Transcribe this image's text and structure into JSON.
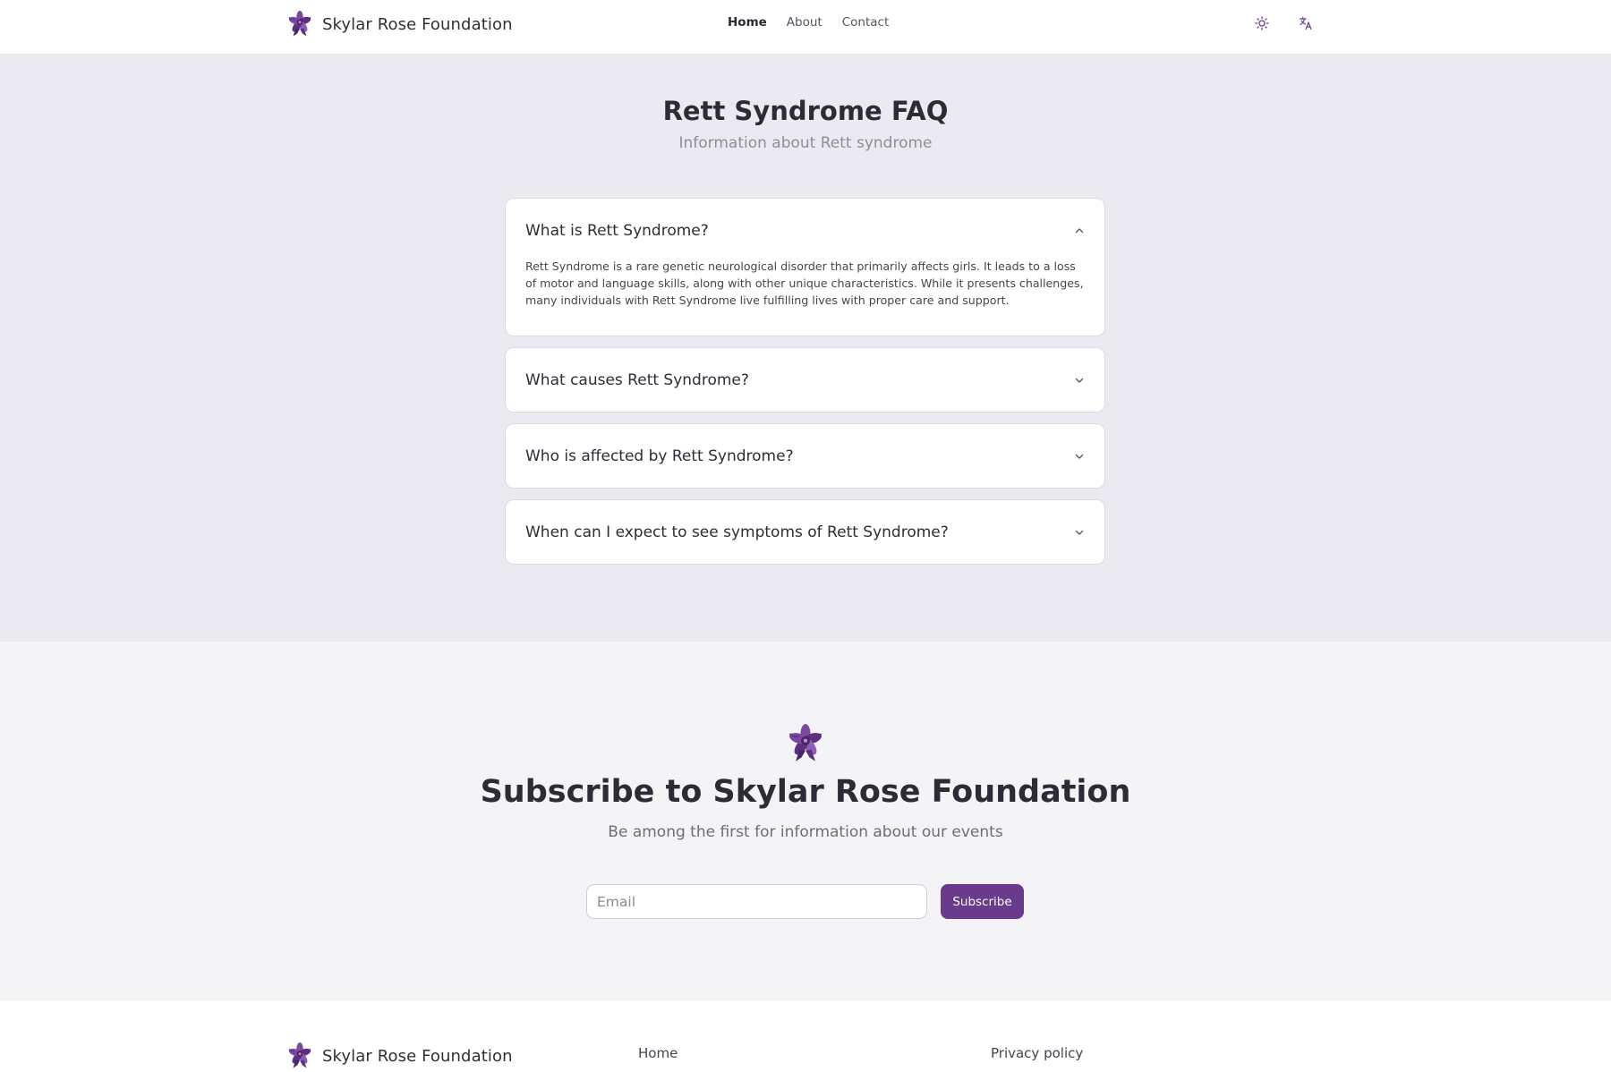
{
  "brand": {
    "name": "Skylar Rose Foundation"
  },
  "nav": {
    "items": [
      {
        "label": "Home",
        "active": true
      },
      {
        "label": "About",
        "active": false
      },
      {
        "label": "Contact",
        "active": false
      }
    ]
  },
  "header_icons": {
    "theme_icon": "sun-icon",
    "language_icon": "translate-icon"
  },
  "faq": {
    "title": "Rett Syndrome FAQ",
    "subtitle": "Information about Rett syndrome",
    "items": [
      {
        "question": "What is Rett Syndrome?",
        "answer": "Rett Syndrome is a rare genetic neurological disorder that primarily affects girls. It leads to a loss of motor and language skills, along with other unique characteristics. While it presents challenges, many individuals with Rett Syndrome live fulfilling lives with proper care and support.",
        "expanded": true
      },
      {
        "question": "What causes Rett Syndrome?",
        "expanded": false
      },
      {
        "question": "Who is affected by Rett Syndrome?",
        "expanded": false
      },
      {
        "question": "When can I expect to see symptoms of Rett Syndrome?",
        "expanded": false
      }
    ]
  },
  "subscribe": {
    "title": "Subscribe to Skylar Rose Foundation",
    "description": "Be among the first for information about our events",
    "email_placeholder": "Email",
    "email_value": "",
    "button_label": "Subscribe"
  },
  "footer": {
    "brand_name": "Skylar Rose Foundation",
    "links": {
      "home": "Home",
      "privacy": "Privacy policy"
    }
  },
  "colors": {
    "accent": "#6a3a8c",
    "faq_background": "#eceaf1",
    "page_background": "#f4f4f7"
  }
}
